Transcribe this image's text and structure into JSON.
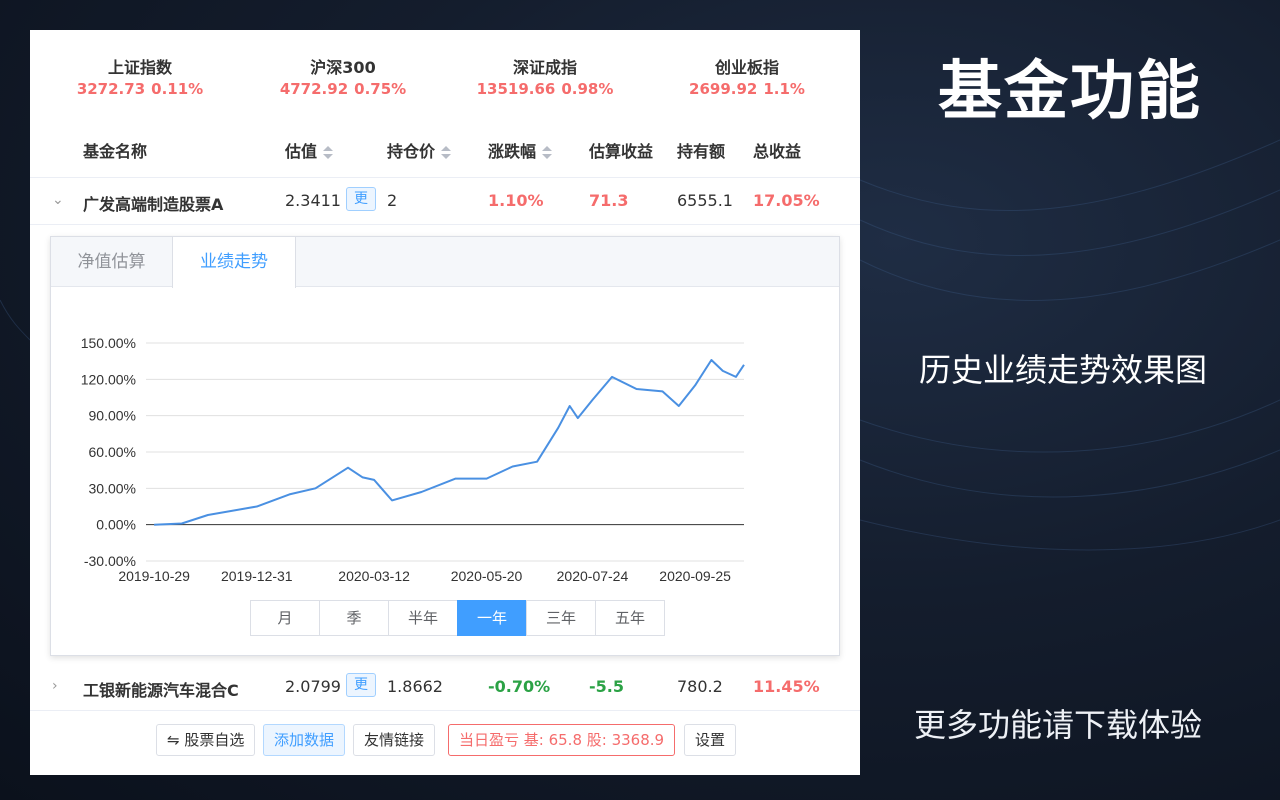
{
  "indices": [
    {
      "name": "上证指数",
      "value": "3272.73",
      "change": "0.11%"
    },
    {
      "name": "沪深300",
      "value": "4772.92",
      "change": "0.75%"
    },
    {
      "name": "深证成指",
      "value": "13519.66",
      "change": "0.98%"
    },
    {
      "name": "创业板指",
      "value": "2699.92",
      "change": "1.1%"
    }
  ],
  "table": {
    "headers": {
      "name": "基金名称",
      "estimate": "估值",
      "cost": "持仓价",
      "change": "涨跌幅",
      "est_profit": "估算收益",
      "holding": "持有额",
      "total_profit": "总收益"
    },
    "update_label": "更",
    "rows": [
      {
        "name": "广发高端制造股票A",
        "estimate": "2.3411",
        "cost": "2",
        "change": "1.10%",
        "est_profit": "71.3",
        "holding": "6555.1",
        "total_profit": "17.05%",
        "expanded": true
      },
      {
        "name": "工银新能源汽车混合C",
        "estimate": "2.0799",
        "cost": "1.8662",
        "change": "-0.70%",
        "est_profit": "-5.5",
        "holding": "780.2",
        "total_profit": "11.45%",
        "expanded": false
      }
    ]
  },
  "detail": {
    "tabs": [
      "净值估算",
      "业绩走势"
    ],
    "active_tab": "业绩走势",
    "ranges": [
      "月",
      "季",
      "半年",
      "一年",
      "三年",
      "五年"
    ],
    "active_range": "一年"
  },
  "chart_data": {
    "type": "line",
    "title": "",
    "xlabel": "",
    "ylabel": "",
    "y_ticks": [
      "150.00%",
      "120.00%",
      "90.00%",
      "60.00%",
      "30.00%",
      "0.00%",
      "-30.00%"
    ],
    "x_ticks": [
      "2019-10-29",
      "2019-12-31",
      "2020-03-12",
      "2020-05-20",
      "2020-07-24",
      "2020-09-25"
    ],
    "ylim": [
      -30,
      150
    ],
    "grid": true,
    "color": "#4a90e2",
    "series": [
      {
        "x": [
          "2019-10-29",
          "2019-11-15",
          "2019-12-01",
          "2019-12-31",
          "2020-01-20",
          "2020-02-05",
          "2020-02-25",
          "2020-03-05",
          "2020-03-12",
          "2020-03-23",
          "2020-04-10",
          "2020-05-01",
          "2020-05-20",
          "2020-06-05",
          "2020-06-20",
          "2020-07-03",
          "2020-07-10",
          "2020-07-15",
          "2020-07-24",
          "2020-08-05",
          "2020-08-20",
          "2020-09-05",
          "2020-09-15",
          "2020-09-25",
          "2020-10-05",
          "2020-10-12",
          "2020-10-20",
          "2020-10-25"
        ],
        "y": [
          0,
          1,
          8,
          15,
          25,
          30,
          47,
          39,
          37,
          20,
          27,
          38,
          38,
          48,
          52,
          80,
          98,
          88,
          103,
          122,
          112,
          110,
          98,
          115,
          136,
          127,
          122,
          132
        ]
      }
    ]
  },
  "footer": {
    "stocks_btn": "⇋ 股票自选",
    "add_btn": "添加数据",
    "links_btn": "友情链接",
    "profit_label": "当日盈亏 基: 65.8   股: 3368.9",
    "settings_btn": "设置"
  },
  "promo": {
    "title": "基金功能",
    "subtitle": "历史业绩走势效果图",
    "cta": "更多功能请下载体验"
  }
}
